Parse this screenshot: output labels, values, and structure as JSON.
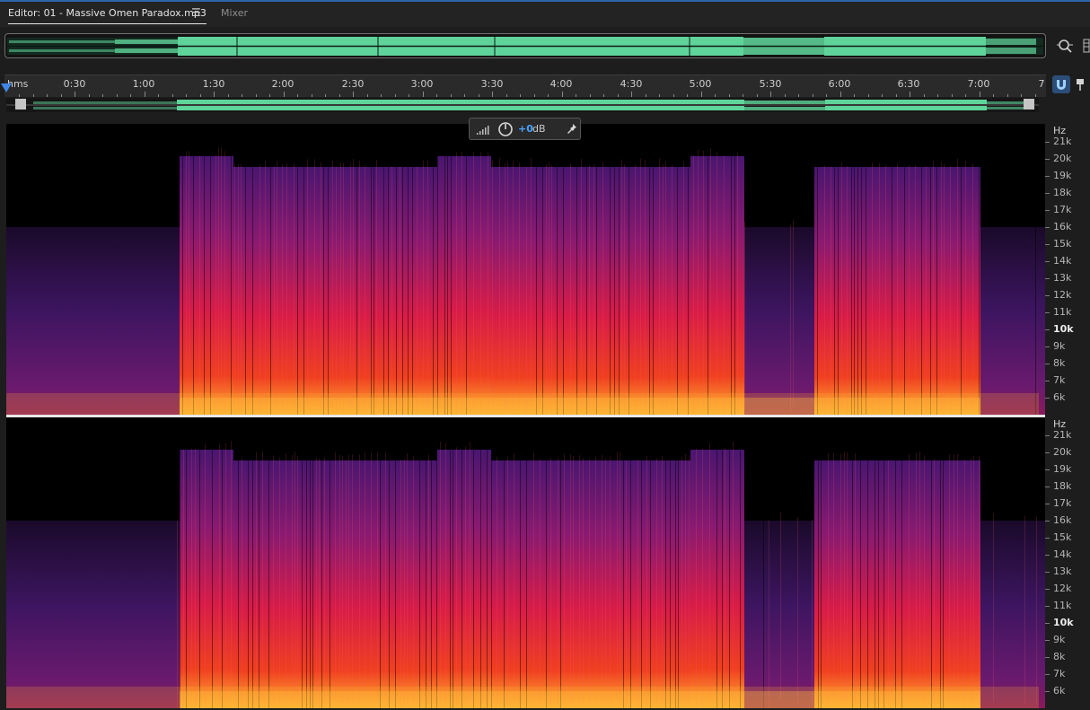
{
  "tabs": {
    "editor": "Editor: 01 - Massive Omen Paradox.mp3",
    "menu_glyph": "☰",
    "mixer": "Mixer"
  },
  "ruler": {
    "unit": "hms",
    "labels": [
      "0:30",
      "1:00",
      "1:30",
      "2:00",
      "2:30",
      "3:00",
      "3:30",
      "4:00",
      "4:30",
      "5:00",
      "5:30",
      "6:00",
      "6:30",
      "7:00",
      "7"
    ]
  },
  "hud": {
    "gain": "+0",
    "unit": "dB"
  },
  "frequency_axis": {
    "unit": "Hz",
    "labels": [
      "21k",
      "20k",
      "19k",
      "18k",
      "17k",
      "16k",
      "15k",
      "14k",
      "13k",
      "12k",
      "11k",
      "10k",
      "9k",
      "8k",
      "7k",
      "6k"
    ]
  },
  "icons": {
    "volume": "volume-bars-icon",
    "knob": "gain-knob-icon",
    "pin": "pin-icon",
    "zoom": "zoom-icon",
    "snap": "snap-magnet-icon",
    "marker": "marker-pin-icon"
  },
  "colors": {
    "waveform": "#5fd49a",
    "accent": "#3f86e6",
    "spectral_high": "#ffb030",
    "spectral_mid": "#e0203a",
    "spectral_low": "#5a1a78"
  }
}
